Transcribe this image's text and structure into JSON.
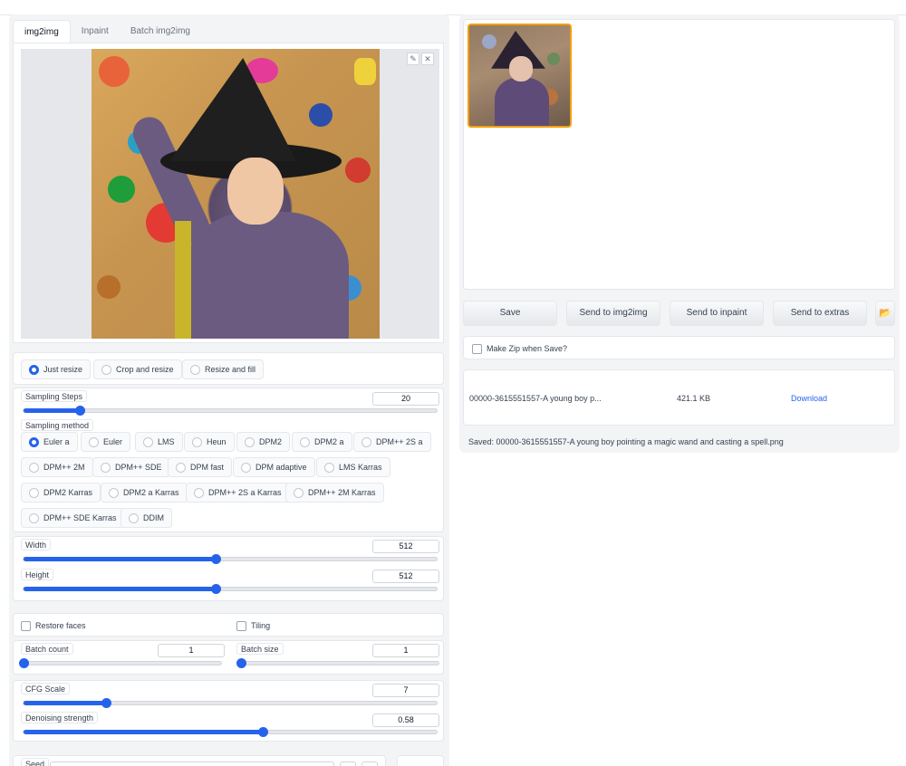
{
  "tabs": [
    "img2img",
    "Inpaint",
    "Batch img2img"
  ],
  "image_buttons": {
    "edit": "✎",
    "close": "✕"
  },
  "resize_mode": {
    "options": [
      "Just resize",
      "Crop and resize",
      "Resize and fill"
    ],
    "selected": "Just resize"
  },
  "sampling_steps": {
    "label": "Sampling Steps",
    "value": "20",
    "fraction": 0.136
  },
  "sampling_method": {
    "label": "Sampling method",
    "selected": "Euler a",
    "options": [
      "Euler a",
      "Euler",
      "LMS",
      "Heun",
      "DPM2",
      "DPM2 a",
      "DPM++ 2S a",
      "DPM++ 2M",
      "DPM++ SDE",
      "DPM fast",
      "DPM adaptive",
      "LMS Karras",
      "DPM2 Karras",
      "DPM2 a Karras",
      "DPM++ 2S a Karras",
      "DPM++ 2M Karras",
      "DPM++ SDE Karras",
      "DDIM"
    ]
  },
  "width": {
    "label": "Width",
    "value": "512",
    "fraction": 0.465
  },
  "height": {
    "label": "Height",
    "value": "512",
    "fraction": 0.465
  },
  "restore_faces": {
    "label": "Restore faces"
  },
  "tiling": {
    "label": "Tiling"
  },
  "batch_count": {
    "label": "Batch count",
    "value": "1",
    "fraction": 0.0
  },
  "batch_size": {
    "label": "Batch size",
    "value": "1",
    "fraction": 0.0
  },
  "cfg_scale": {
    "label": "CFG Scale",
    "value": "7",
    "fraction": 0.2
  },
  "denoising": {
    "label": "Denoising strength",
    "value": "0.58",
    "fraction": 0.58
  },
  "seed": {
    "label": "Seed"
  },
  "output_buttons": [
    "Save",
    "Send to img2img",
    "Send to inpaint",
    "Send to extras"
  ],
  "folder_icon": "📂",
  "make_zip": {
    "label": "Make Zip when Save?"
  },
  "file": {
    "name": "00000-3615551557-A young boy p...",
    "size": "421.1 KB",
    "download": "Download"
  },
  "saved_text": "Saved: 00000-3615551557-A young boy pointing a magic wand and casting a spell.png",
  "colors": {
    "accent": "#2563eb",
    "selection": "#f59e0b"
  }
}
